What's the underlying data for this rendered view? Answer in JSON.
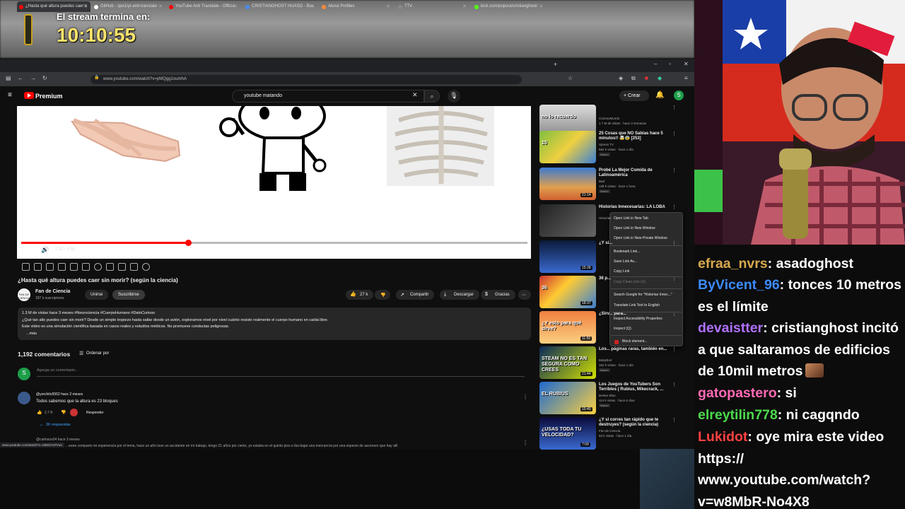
{
  "stream_overlay": {
    "timer_label": "El stream termina en:",
    "timer_value": "10:10:55"
  },
  "browser": {
    "tabs": [
      {
        "label": "¿Hasta qué altura puedes caer s",
        "active": true,
        "color": "#ff0000"
      },
      {
        "label": "GitHub - zpe1/yt-anti-translate",
        "active": false,
        "color": "#ffffff"
      },
      {
        "label": "YouTube Anti Translate - Officia",
        "active": false,
        "color": "#ff0000"
      },
      {
        "label": "CRISTIANGHOST HUASO - Bus",
        "active": false,
        "color": "#4a8af4"
      },
      {
        "label": "About Profiles",
        "active": false,
        "color": "#ff8a3a"
      },
      {
        "label": "7TV",
        "active": false,
        "color": "#888888"
      },
      {
        "label": "kick.com/popout/cristianghost/",
        "active": false,
        "color": "#53fc18"
      }
    ],
    "url": "www.youtube.com/watch?v=pMQgg1oumhA"
  },
  "youtube": {
    "logo_text": "Premium",
    "search_value": "youtube matando",
    "create_label": "Crear",
    "avatar_letter": "S",
    "player": {
      "time": "1:37 / 4:58",
      "progress": 0.33
    },
    "video_title": "¿Hasta qué altura puedes caer sin morir? (según la ciencia)",
    "channel": {
      "name": "Fan de Ciencia",
      "subs": "187 k suscriptores",
      "avatar_text": "FAN DE CIENCIA"
    },
    "buttons": {
      "join": "Unirse",
      "subscribe": "Suscribirse",
      "likes": "27 k",
      "share": "Compartir",
      "download": "Descargar",
      "thanks": "Gracias"
    },
    "description": {
      "stats": "1.3 M de vistas  hace 3 meses  #Neurociencia #CuerpoHumano #DatoCurioso",
      "line1": "¿Qué tan alto puedes caer sin morir? Desde un simple tropiezo hasta saltar desde un avión, exploramos nivel por nivel cuánto resiste realmente el cuerpo humano en caída libre.",
      "line2": "Este video es una simulación científica basada en casos reales y estudios médicos. No promueve conductas peligrosas.",
      "more": "...más"
    },
    "comments": {
      "count": "1,192 comentarios",
      "sort": "Ordenar por",
      "input_placeholder": "Agrega un comentario...",
      "first": {
        "user": "@yorchito5552  hace 2 meses",
        "text": "Todos sabemos que la altura es 23 bloques",
        "likes": "2.7 K",
        "reply": "Responder",
        "replies": "36 respuestas"
      },
      "second": {
        "user": "@carlosos04  hace 3 meses",
        "text": "...eeee comparto mi experiencia por el tema, hace un año tuve un accidente en mi trabajo, tengo 21 años por cierto, yo estaba en el quinto piso e iba bajar una mercancía por una especie de ascensor que hay allí"
      }
    },
    "status_url": "www.youtube.com/watch?v=S98OA1PVua"
  },
  "sidebar": [
    {
      "title": "",
      "channel": "CuriosoMundo",
      "meta": "1.7 M de vistas · hace 3 semanas",
      "new": "",
      "duration": "",
      "thumb_text": "no lo recuerdo"
    },
    {
      "title": "25 Cosas que NO Sabías hace 5 minutos!! 🤯😰 [253]",
      "channel": "Xpress TV",
      "meta": "664 k vistas · hace 1 día",
      "new": "Nuevo",
      "duration": "",
      "thumb_text": "15"
    },
    {
      "title": "Probé La Mejor Comida de Latinoamérica",
      "channel": "Bad",
      "meta": "138 k vistas · hace 1 hora",
      "new": "Nuevo",
      "duration": "21:14",
      "thumb_text": ""
    },
    {
      "title": "Historias Innecesarias: LA LOBA",
      "channel": "Historias",
      "meta": "",
      "new": "",
      "duration": "",
      "thumb_text": ""
    },
    {
      "title": "¿Y si...",
      "channel": "",
      "meta": "",
      "new": "",
      "duration": "15:39",
      "thumb_text": ""
    },
    {
      "title": "36 p...",
      "channel": "",
      "meta": "",
      "new": "",
      "duration": "18:37",
      "thumb_text": "36"
    },
    {
      "title": "¿Sirv... para...",
      "channel": "",
      "meta": "",
      "new": "",
      "duration": "11:55",
      "thumb_text": "¿Y esto para qué sirve?"
    },
    {
      "title": "Los... páginas raras, también en...",
      "channel": "BabyBurr",
      "meta": "162 k vistas · hace 1 día",
      "new": "Nuevo",
      "duration": "21:44",
      "thumb_text": "STEAM NO ES TAN SEGURA COMO CREES"
    },
    {
      "title": "Los Juegos de YouTubers Son Terribles ( Rubius, Mikecrack, ...",
      "channel": "Derker Blue",
      "meta": "114 k vistas · hace 6 días",
      "new": "Nuevo",
      "duration": "15:40",
      "thumb_text": "EL RUBIUS"
    },
    {
      "title": "¿Y si corres tan rápido que te destruyes? (según la ciencia)",
      "channel": "Fan de Ciencia",
      "meta": "93 k vistas · hace 1 día",
      "new": "",
      "duration": "7:09",
      "thumb_text": "¿USAS TODA TU VELOCIDAD?"
    }
  ],
  "context_menu": [
    {
      "label": "Open Link in New Tab",
      "disabled": false
    },
    {
      "label": "Open Link in New Window",
      "disabled": false
    },
    {
      "label": "Open Link in New Private Window",
      "disabled": false
    },
    {
      "label": "Bookmark Link...",
      "disabled": false
    },
    {
      "label": "Save Link As...",
      "disabled": false
    },
    {
      "label": "Copy Link",
      "disabled": false
    },
    {
      "label": "Copy Clean Link (U)",
      "disabled": true
    },
    {
      "label": "Search Google for \"Historias Innec...\"",
      "disabled": false
    },
    {
      "label": "Translate Link Text to English",
      "disabled": false
    },
    {
      "label": "Inspect Accessibility Properties",
      "disabled": false
    },
    {
      "label": "Inspect (Q)",
      "disabled": false
    },
    {
      "label": "Block element...",
      "disabled": false
    }
  ],
  "chat": [
    {
      "user": "efraa_nvrs",
      "color": "#d8a94e",
      "text": "asadoghost"
    },
    {
      "user": "ByVicent_96",
      "color": "#3b8cff",
      "text": "tonces 10 metros es el límite"
    },
    {
      "user": "devaistter",
      "color": "#b070ff",
      "text": "cristianghost incitó a que saltaramos de edificios de 10mil metros"
    },
    {
      "user": "gatopastero",
      "color": "#ff69b4",
      "text": "si"
    },
    {
      "user": "elreytilin778",
      "color": "#4cd94c",
      "text": "ni cagqndo"
    },
    {
      "user": "Lukidot",
      "color": "#ff4040",
      "text": "oye  mira este video https:// www.youtube.com/watch? v=w8MbR-No4X8"
    }
  ]
}
